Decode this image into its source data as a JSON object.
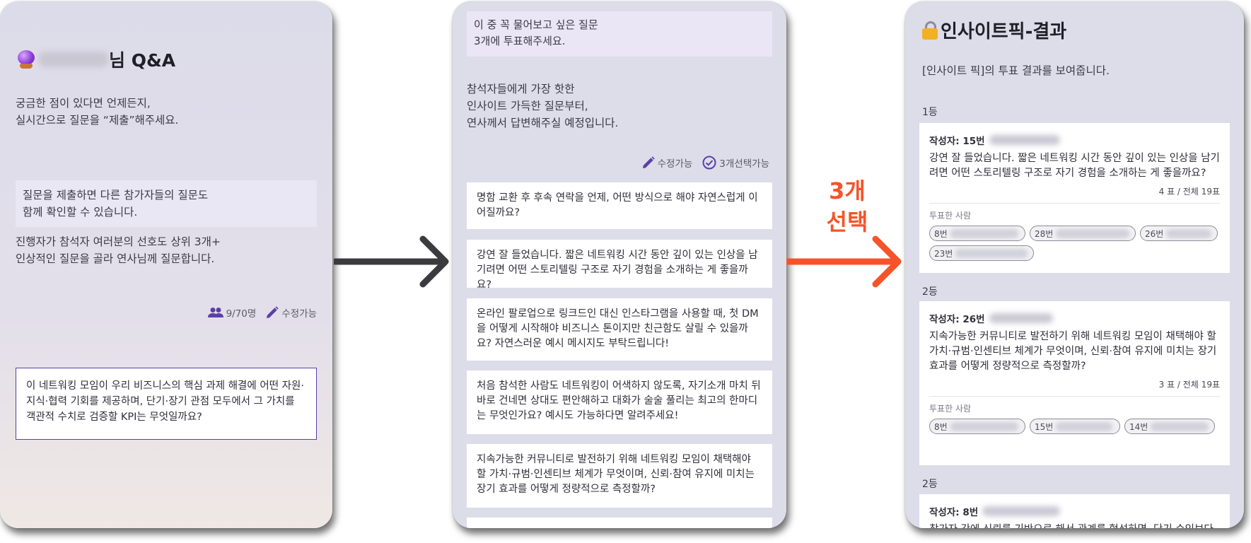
{
  "panel1": {
    "title_suffix": "님 Q&A",
    "intro": "궁금한 점이 있다면 언제든지,\n실시간으로 질문을 “제출”해주세요.",
    "notice": "질문을 제출하면 다른 참가자들의 질문도\n함께 확인할 수 있습니다.",
    "desc": "진행자가 참석자 여러분의 선호도 상위 3개+\n인상적인 질문을 골라 연사님께 질문합니다.",
    "participants": "9/70명",
    "editable": "수정가능",
    "question": "이 네트워킹 모임이 우리 비즈니스의 핵심 과제 해결에 어떤 자원·지식·협력 기회를 제공하며, 단기·장기 관점 모두에서 그 가치를 객관적 수치로 검증할 KPI는 무엇일까요?"
  },
  "panel2": {
    "prompt": "이 중 꼭 물어보고 싶은 질문\n3개에 투표해주세요.",
    "intro": "참석자들에게 가장 핫한\n인사이트 가득한 질문부터,\n연사께서 답변해주실 예정입니다.",
    "editable": "수정가능",
    "select_limit": "3개선택가능",
    "questions": [
      "명함 교환 후 후속 연락을 언제, 어떤 방식으로 해야 자연스럽게 이어질까요?",
      "강연 잘 들었습니다. 짧은 네트워킹 시간 동안 깊이 있는 인상을 남기려면 어떤 스토리텔링 구조로 자기 경험을 소개하는 게 좋을까요?",
      "온라인 팔로업으로 링크드인 대신 인스타그램을 사용할 때, 첫 DM을 어떻게 시작해야 비즈니스 톤이지만 친근함도 살릴 수 있을까요? 자연스러운 예시 메시지도 부탁드립니다!",
      "처음 참석한 사람도 네트워킹이 어색하지 않도록, 자기소개 마치 뒤 바로 건네면 상대도 편안해하고 대화가 술술 풀리는 최고의 한마디는 무엇인가요? 예시도 가능하다면 알려주세요!",
      "지속가능한 커뮤니티로 발전하기 위해 네트워킹 모임이 채택해야 할 가치·규범·인센티브 체계가 무엇이며, 신뢰·참여 유지에 미치는 장기 효과를 어떻게 정량적으로 측정할까?"
    ]
  },
  "arrow_label": "3개\n선택",
  "panel3": {
    "title": "인사이트픽-결과",
    "desc": "[인사이트 픽]의 투표 결과를 보여줍니다.",
    "voters_label": "투표한 사람",
    "results": [
      {
        "rank": "1등",
        "author": "작성자: 15번",
        "question": "강연 잘 들었습니다. 짧은 네트워킹 시간 동안 깊이 있는 인상을 남기려면 어떤 스토리텔링 구조로 자기 경험을 소개하는 게 좋을까요?",
        "votes": "4 표 / 전체 19표",
        "voters": [
          "8번",
          "28번",
          "26번",
          "23번"
        ]
      },
      {
        "rank": "2등",
        "author": "작성자: 26번",
        "question": "지속가능한 커뮤니티로 발전하기 위해 네트워킹 모임이 채택해야 할 가치·규범·인센티브 체계가 무엇이며, 신뢰·참여 유지에 미치는 장기 효과를 어떻게 정량적으로 측정할까?",
        "votes": "3 표 / 전체 19표",
        "voters": [
          "8번",
          "15번",
          "14번"
        ]
      },
      {
        "rank": "2등",
        "author": "작성자: 8번",
        "question": "참가자 간에 신뢰를 기반으로 해서 관계를 형성하면, 단기 수익보다"
      }
    ]
  },
  "colors": {
    "accent_purple": "#5a3fa8",
    "arrow_orange": "#f5542a",
    "arrow_dark": "#3b3b3f"
  },
  "icons": [
    "crystal-ball-icon",
    "people-icon",
    "pencil-icon",
    "check-circle-icon",
    "lock-icon",
    "arrow-right-icon"
  ]
}
